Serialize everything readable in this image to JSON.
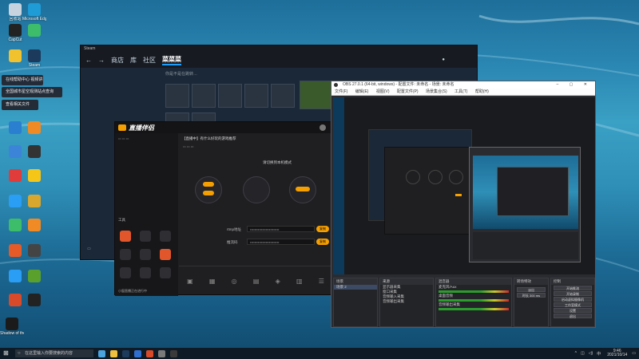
{
  "desktop": {
    "icons": [
      {
        "label": "回收站",
        "color": "#c7d3de"
      },
      {
        "label": "Microsoft Edge",
        "color": "#1f9bd6"
      },
      {
        "label": "CapCut",
        "color": "#222222"
      },
      {
        "label": "",
        "color": "#3dbd6a"
      },
      {
        "label": "",
        "color": "#f2c12e"
      },
      {
        "label": "Steam",
        "color": "#1b3a5c"
      },
      {
        "label": "",
        "color": "#2a7fd1"
      },
      {
        "label": "",
        "color": "#f08a24"
      },
      {
        "label": "",
        "color": "#3b84d8"
      },
      {
        "label": "",
        "color": "#333333"
      },
      {
        "label": "",
        "color": "#e03c3c"
      },
      {
        "label": "",
        "color": "#f5c518"
      },
      {
        "label": "",
        "color": "#2a9df4"
      },
      {
        "label": "",
        "color": "#d9a62e"
      },
      {
        "label": "",
        "color": "#3dbd6a"
      },
      {
        "label": "",
        "color": "#f08a24"
      },
      {
        "label": "",
        "color": "#e65a28"
      },
      {
        "label": "",
        "color": "#444444"
      },
      {
        "label": "",
        "color": "#2a9df4"
      },
      {
        "label": "",
        "color": "#5aa02c"
      },
      {
        "label": "",
        "color": "#d94a2a"
      },
      {
        "label": "",
        "color": "#222222"
      },
      {
        "label": "Shadow of the Tomb",
        "color": "#1b1b1b"
      }
    ],
    "toasts": [
      "在线帮助中心 视频讲解",
      "全国城市星空观测站点查询",
      "查看相关文件"
    ]
  },
  "steam": {
    "tabs": [
      "商店",
      "库",
      "社区"
    ],
    "username": "菜菜菜",
    "prompt": "你是不是在跳转…"
  },
  "live_app": {
    "logo": "直播伴侣",
    "title": "【直播中】有什么好玩的游戏推荐",
    "mode_label": "请切换到本机模式",
    "tools_label": "工具",
    "stream_url_label": "rtmp地址",
    "stream_key_label": "推流码",
    "copy_label": "复制",
    "bottom_hint": "小窗直播正在进行中"
  },
  "obs": {
    "title": "OBS 27.0.1 (64-bit, windows) - 配置文件: 未命名 - 场景: 未命名",
    "menu": [
      "文件(F)",
      "编辑(E)",
      "视图(V)",
      "配置文件(P)",
      "场景集合(S)",
      "工具(T)",
      "帮助(H)"
    ],
    "docks": {
      "scenes": {
        "title": "场景",
        "items": [
          "场景 2"
        ]
      },
      "sources": {
        "title": "来源",
        "items": [
          "显示器采集",
          "窗口采集",
          "音频输入采集",
          "音频输出采集"
        ]
      },
      "mixer": {
        "title": "混音器",
        "items": [
          "麦克风/Aux",
          "桌面音频",
          "音频输出采集"
        ]
      },
      "transitions": {
        "title": "转场特效",
        "items": [
          "淡出",
          "时长 300 ms"
        ]
      },
      "controls": {
        "title": "控制",
        "buttons": [
          "开始推流",
          "开始录制",
          "启动虚拟摄像机",
          "工作室模式",
          "设置",
          "退出"
        ]
      }
    }
  },
  "taskbar": {
    "search_placeholder": "在这里输入你要搜索的内容",
    "time": "9:46",
    "date": "2021/10/14",
    "lang": "中",
    "icon_colors": [
      "#4aa3df",
      "#f0c040",
      "#1b3a5c",
      "#2f6fd0",
      "#d94a2a",
      "#7a7a7a",
      "#3a3a3a"
    ]
  }
}
